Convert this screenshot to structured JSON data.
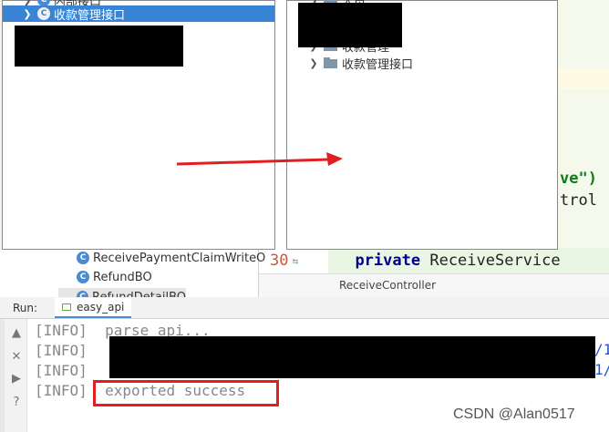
{
  "left_dialog": {
    "top_item_label": "内部接口",
    "selected_item_label": "收款管理接口",
    "class_icon": "C"
  },
  "right_dialog": {
    "top_item_label": "人员",
    "item_1_label": "收款管理",
    "item_2_label": "收款管理接口"
  },
  "editor": {
    "code_fragment_1": "ve\")",
    "code_fragment_2": "trol",
    "line_number": "30",
    "keyword": "private",
    "type_name": "ReceiveService",
    "tab_label": "ReceiveController"
  },
  "project_tree": {
    "items": [
      {
        "label": "ReceivePaymentClaimWriteO"
      },
      {
        "label": "RefundBO"
      },
      {
        "label": "RefundDetailBO"
      }
    ]
  },
  "run_panel": {
    "run_label": "Run:",
    "tab_label": "easy_api",
    "output_lines": [
      "[INFO]  parse api...",
      "[INFO]",
      "[INFO]",
      "[INFO]  exported success"
    ],
    "link_fragments": [
      "/1",
      "1/"
    ]
  },
  "watermark": "CSDN @Alan0517",
  "colors": {
    "selection_blue": "#3a84d6",
    "highlight_red": "#e02020",
    "keyword_blue": "#00008b",
    "string_green": "#0a7d16"
  }
}
